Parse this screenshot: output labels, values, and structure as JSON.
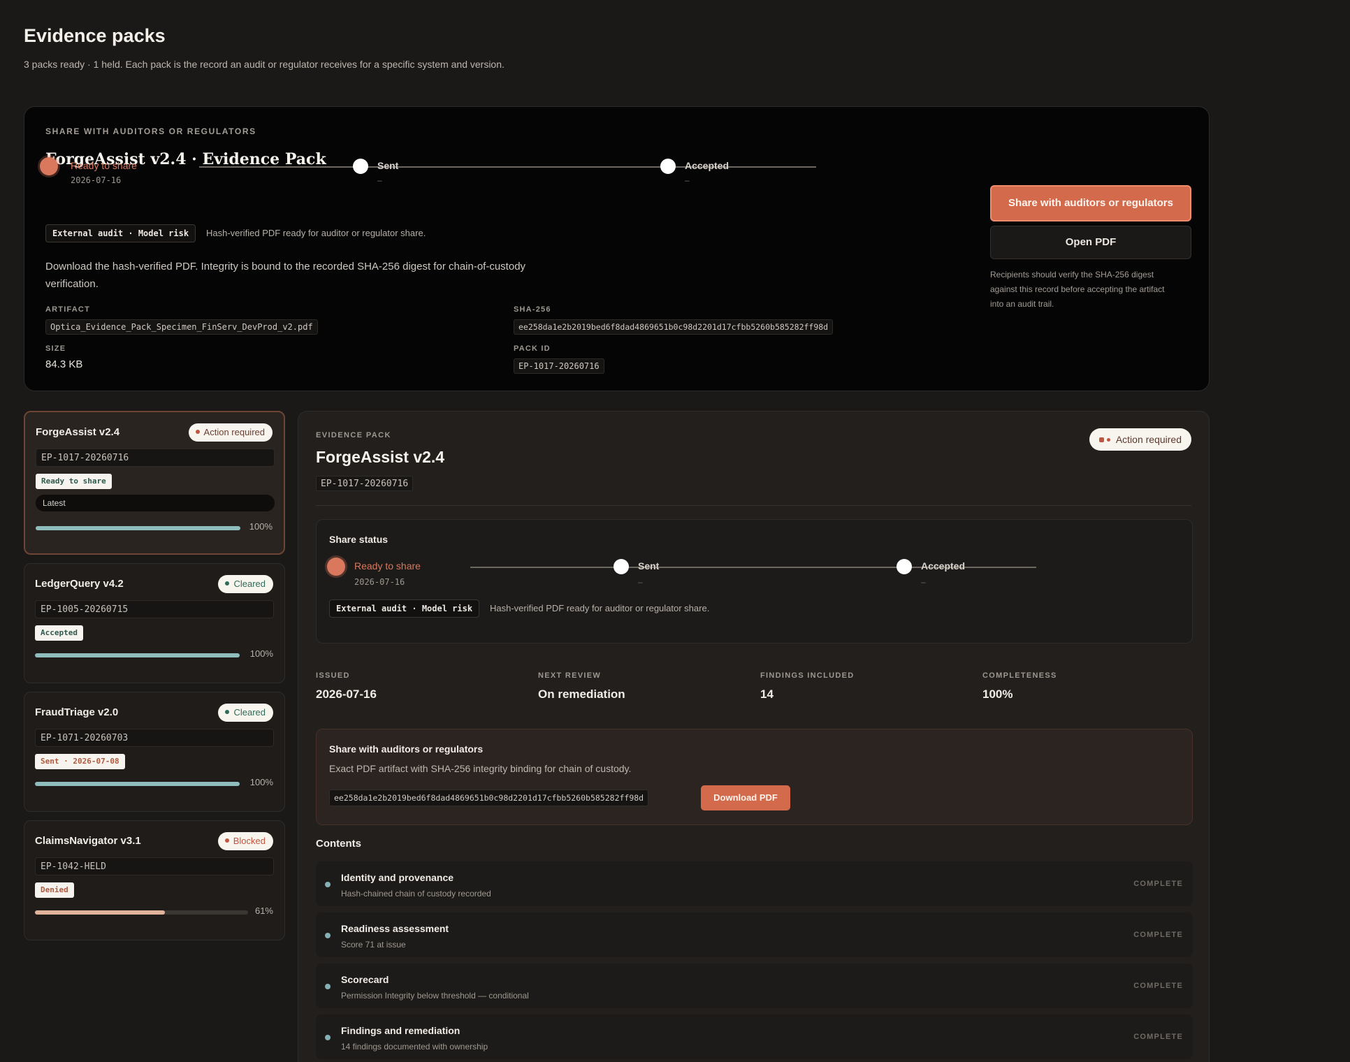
{
  "header": {
    "title": "Evidence packs",
    "subtitle": "3 packs ready · 1 held. Each pack is the record an audit or regulator receives for a specific system and version."
  },
  "share_card": {
    "eyebrow": "SHARE WITH AUDITORS OR REGULATORS",
    "title": "ForgeAssist v2.4 · Evidence Pack",
    "timeline": {
      "step1_label": "Ready to share",
      "step1_date": "2026-07-16",
      "step2_label": "Sent",
      "step2_date": "–",
      "step3_label": "Accepted",
      "step3_date": "–"
    },
    "tag": "External audit · Model risk",
    "tag_note": "Hash-verified PDF ready for auditor or regulator share.",
    "description": "Download the hash-verified PDF. Integrity is bound to the recorded SHA-256 digest for chain-of-custody verification.",
    "artifact_label": "ARTIFACT",
    "artifact_value": "Optica_Evidence_Pack_Specimen_FinServ_DevProd_v2.pdf",
    "sha_label": "SHA-256",
    "sha_value": "ee258da1e2b2019bed6f8dad4869651b0c98d2201d17cfbb5260b585282ff98d",
    "size_label": "SIZE",
    "size_value": "84.3 KB",
    "pack_id_label": "PACK ID",
    "pack_id_value": "EP-1017-20260716",
    "primary_button": "Share with auditors or regulators",
    "secondary_button": "Open PDF",
    "help": "Recipients should verify the SHA-256 digest against this record before accepting the artifact into an audit trail."
  },
  "packs": [
    {
      "name": "ForgeAssist v2.4",
      "badge": "Action required",
      "id": "EP-1017-20260716",
      "status": "Ready to share",
      "latest": "Latest",
      "progress": 100,
      "pct": "100%"
    },
    {
      "name": "LedgerQuery v4.2",
      "badge": "Cleared",
      "id": "EP-1005-20260715",
      "status": "Accepted",
      "progress": 100,
      "pct": "100%"
    },
    {
      "name": "FraudTriage v2.0",
      "badge": "Cleared",
      "id": "EP-1071-20260703",
      "status": "Sent · 2026-07-08",
      "progress": 100,
      "pct": "100%"
    },
    {
      "name": "ClaimsNavigator v3.1",
      "badge": "Blocked",
      "id": "EP-1042-HELD",
      "status": "Denied",
      "progress": 61,
      "pct": "61%"
    }
  ],
  "detail": {
    "eyebrow": "EVIDENCE PACK",
    "title": "ForgeAssist v2.4",
    "id": "EP-1017-20260716",
    "badge": "Action required",
    "share_status": {
      "title": "Share status",
      "step1_label": "Ready to share",
      "step1_date": "2026-07-16",
      "step2_label": "Sent",
      "step2_date": "–",
      "step3_label": "Accepted",
      "step3_date": "–",
      "tag": "External audit · Model risk",
      "tag_note": "Hash-verified PDF ready for auditor or regulator share."
    },
    "stats": [
      {
        "label": "ISSUED",
        "value": "2026-07-16"
      },
      {
        "label": "NEXT REVIEW",
        "value": "On remediation"
      },
      {
        "label": "FINDINGS INCLUDED",
        "value": "14"
      },
      {
        "label": "COMPLETENESS",
        "value": "100%"
      }
    ],
    "download": {
      "title": "Share with auditors or regulators",
      "subtitle": "Exact PDF artifact with SHA-256 integrity binding for chain of custody.",
      "hash": "ee258da1e2b2019bed6f8dad4869651b0c98d2201d17cfbb5260b585282ff98d",
      "button": "Download PDF"
    },
    "contents_title": "Contents",
    "contents": [
      {
        "title": "Identity and provenance",
        "subtitle": "Hash-chained chain of custody recorded",
        "status": "COMPLETE"
      },
      {
        "title": "Readiness assessment",
        "subtitle": "Score 71 at issue",
        "status": "COMPLETE"
      },
      {
        "title": "Scorecard",
        "subtitle": "Permission Integrity below threshold — conditional",
        "status": "COMPLETE"
      },
      {
        "title": "Findings and remediation",
        "subtitle": "14 findings documented with ownership",
        "status": "COMPLETE"
      }
    ]
  },
  "colors": {
    "accent": "#d46a4c",
    "progress_teal": "#8fbcbc",
    "progress_tan": "#e0b39a",
    "cleared_green": "#2f6b5b",
    "blocked_red": "#c0563f"
  }
}
